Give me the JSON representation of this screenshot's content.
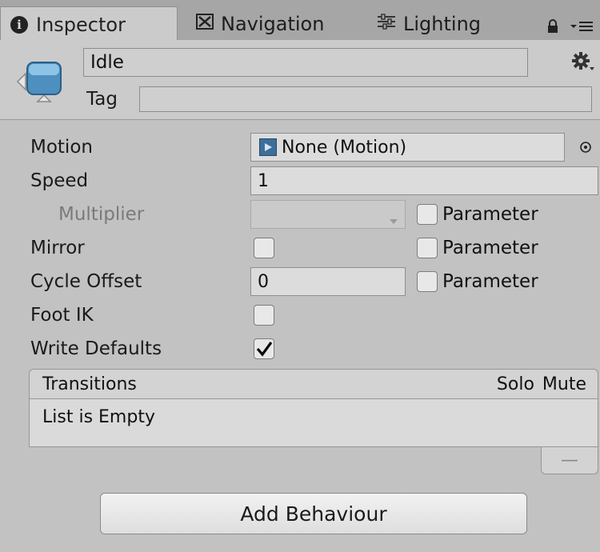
{
  "tabs": [
    {
      "label": "Inspector",
      "icon": "info-icon",
      "active": true
    },
    {
      "label": "Navigation",
      "icon": "navigation-icon",
      "active": false
    },
    {
      "label": "Lighting",
      "icon": "lighting-icon",
      "active": false
    }
  ],
  "header": {
    "name_value": "Idle",
    "tag_label": "Tag",
    "tag_value": ""
  },
  "fields": {
    "motion": {
      "label": "Motion",
      "value": "None (Motion)"
    },
    "speed": {
      "label": "Speed",
      "value": "1"
    },
    "multiplier": {
      "label": "Multiplier",
      "value": "",
      "param_label": "Parameter",
      "param_checked": false
    },
    "mirror": {
      "label": "Mirror",
      "checked": false,
      "param_label": "Parameter",
      "param_checked": false
    },
    "cycle_offset": {
      "label": "Cycle Offset",
      "value": "0",
      "param_label": "Parameter",
      "param_checked": false
    },
    "foot_ik": {
      "label": "Foot IK",
      "checked": false
    },
    "write_defaults": {
      "label": "Write Defaults",
      "checked": true
    }
  },
  "transitions": {
    "title": "Transitions",
    "col_solo": "Solo",
    "col_mute": "Mute",
    "empty_text": "List is Empty",
    "remove_label": "—"
  },
  "add_behaviour_label": "Add Behaviour"
}
